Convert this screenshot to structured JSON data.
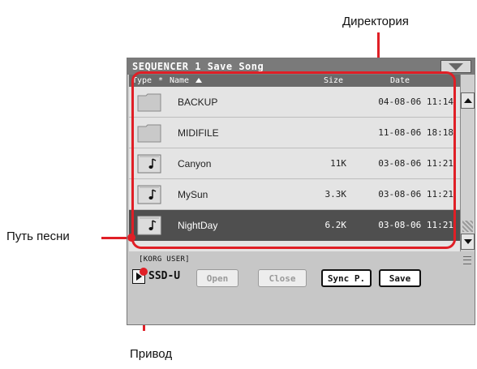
{
  "annotations": {
    "directory": "Директория",
    "song_path": "Путь песни",
    "drive": "Привод"
  },
  "window": {
    "title": "SEQUENCER 1  Save Song"
  },
  "file_list": {
    "columns": [
      "Type",
      "*",
      "Name",
      "Size",
      "Date"
    ],
    "rows": [
      {
        "type": "folder",
        "name": "BACKUP",
        "size": "",
        "date": "04-08-06 11:14",
        "selected": false
      },
      {
        "type": "folder",
        "name": "MIDIFILE",
        "size": "",
        "date": "11-08-06 18:18",
        "selected": false
      },
      {
        "type": "song",
        "name": "Canyon",
        "size": "11K",
        "date": "03-08-06 11:21",
        "selected": false
      },
      {
        "type": "song",
        "name": "MySun",
        "size": "3.3K",
        "date": "03-08-06 11:21",
        "selected": false
      },
      {
        "type": "song",
        "name": "NightDay",
        "size": "6.2K",
        "date": "03-08-06 11:21",
        "selected": true
      }
    ]
  },
  "path": "[KORG USER]",
  "drive": "SSD-U",
  "buttons": {
    "open": "Open",
    "close": "Close",
    "sync": "Sync P.",
    "save": "Save"
  },
  "colors": {
    "annotation_red": "#e01f26",
    "selected_row": "#4f4f4f",
    "title_bar": "#7a7a7a"
  }
}
